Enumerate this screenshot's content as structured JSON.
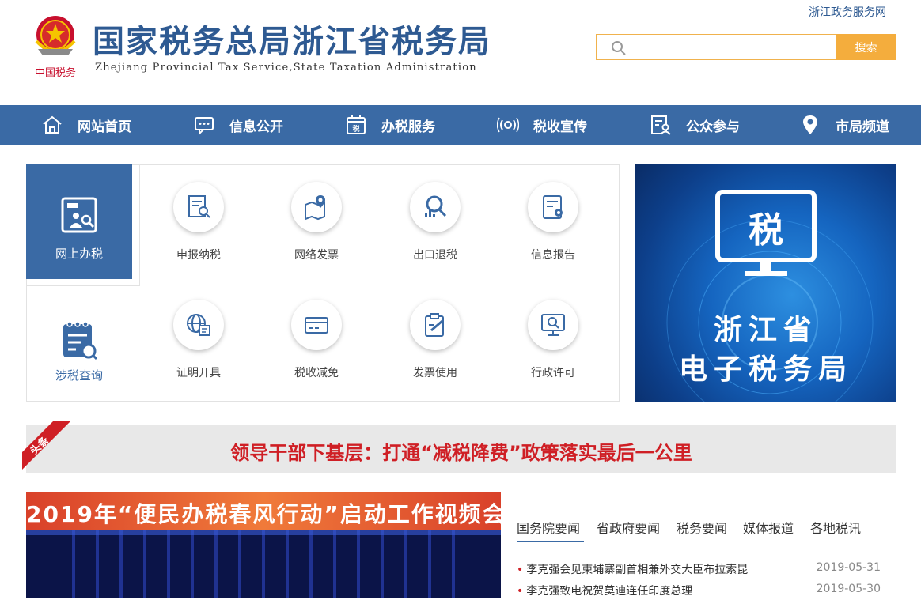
{
  "header": {
    "title_cn": "国家税务总局浙江省税务局",
    "title_en": "Zhejiang Provincial Tax Service,State Taxation Administration",
    "emblem_caption": "中国税务",
    "top_link": "浙江政务服务网",
    "search": {
      "placeholder": "",
      "button_label": "搜索"
    }
  },
  "nav": [
    {
      "label": "网站首页",
      "icon": "home-icon"
    },
    {
      "label": "信息公开",
      "icon": "chat-icon"
    },
    {
      "label": "办税服务",
      "icon": "calendar-tax-icon"
    },
    {
      "label": "税收宣传",
      "icon": "broadcast-icon"
    },
    {
      "label": "公众参与",
      "icon": "user-doc-icon"
    },
    {
      "label": "市局频道",
      "icon": "location-pin-icon"
    }
  ],
  "panel": {
    "tabs": [
      {
        "label": "网上办税",
        "icon": "online-tax-icon",
        "active": true
      },
      {
        "label": "涉税查询",
        "icon": "query-icon",
        "active": false
      }
    ],
    "services": [
      {
        "label": "申报纳税",
        "icon": "declare-icon"
      },
      {
        "label": "网络发票",
        "icon": "map-invoice-icon"
      },
      {
        "label": "出口退税",
        "icon": "search-chart-icon"
      },
      {
        "label": "信息报告",
        "icon": "report-icon"
      },
      {
        "label": "证明开具",
        "icon": "globe-certificate-icon"
      },
      {
        "label": "税收减免",
        "icon": "card-icon"
      },
      {
        "label": "发票使用",
        "icon": "clipboard-edit-icon"
      },
      {
        "label": "行政许可",
        "icon": "monitor-search-icon"
      }
    ]
  },
  "banner": {
    "monitor_char": "税",
    "line1": "浙江省",
    "line2": "电子税务局"
  },
  "headline": {
    "badge": "头条",
    "text": "领导干部下基层：打通“减税降费”政策落实最后一公里"
  },
  "video": {
    "title": "2019年“便民办税春风行动”启动工作视频会"
  },
  "news": {
    "tabs": [
      "国务院要闻",
      "省政府要闻",
      "税务要闻",
      "媒体报道",
      "各地税讯"
    ],
    "active_tab": 0,
    "items": [
      {
        "title": "李克强会见柬埔寨副首相兼外交大臣布拉索昆",
        "date": "2019-05-31"
      },
      {
        "title": "李克强致电祝贺莫迪连任印度总理",
        "date": "2019-05-30"
      }
    ]
  },
  "colors": {
    "primary": "#3a6aa5",
    "accent": "#f4ad3d",
    "headline_red": "#cf1f25"
  }
}
